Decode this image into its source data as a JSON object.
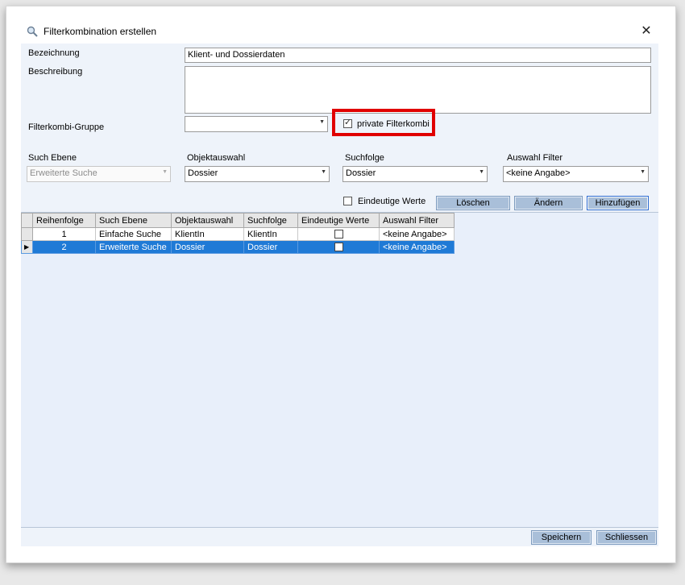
{
  "window": {
    "title": "Filterkombination erstellen",
    "close_symbol": "✕"
  },
  "form": {
    "bezeichnung_label": "Bezeichnung",
    "bezeichnung_value": "Klient- und Dossierdaten",
    "beschreibung_label": "Beschreibung",
    "beschreibung_value": "",
    "gruppe_label": "Filterkombi-Gruppe",
    "gruppe_value": "",
    "private_label": "private Filterkombi",
    "private_checked": true
  },
  "filter_row": {
    "such_ebene_label": "Such Ebene",
    "such_ebene_value": "Erweiterte Suche",
    "objektauswahl_label": "Objektauswahl",
    "objektauswahl_value": "Dossier",
    "suchfolge_label": "Suchfolge",
    "suchfolge_value": "Dossier",
    "auswahl_filter_label": "Auswahl Filter",
    "auswahl_filter_value": "<keine Angabe>",
    "eindeutige_label": "Eindeutige Werte",
    "eindeutige_checked": false
  },
  "buttons": {
    "loeschen": "Löschen",
    "aendern": "Ändern",
    "hinzufuegen": "Hinzufügen",
    "speichern": "Speichern",
    "schliessen": "Schliessen"
  },
  "grid": {
    "columns": [
      "Reihenfolge",
      "Such Ebene",
      "Objektauswahl",
      "Suchfolge",
      "Eindeutige Werte",
      "Auswahl Filter"
    ],
    "rows": [
      {
        "reihenfolge": "1",
        "such_ebene": "Einfache Suche",
        "objektauswahl": "KlientIn",
        "suchfolge": "KlientIn",
        "eindeutige": false,
        "auswahl_filter": "<keine Angabe>",
        "selected": false
      },
      {
        "reihenfolge": "2",
        "such_ebene": "Erweiterte Suche",
        "objektauswahl": "Dossier",
        "suchfolge": "Dossier",
        "eindeutige": false,
        "auswahl_filter": "<keine Angabe>",
        "selected": true
      }
    ],
    "current_row_marker": "▶"
  },
  "icons": {
    "title_icon": "magnifier-icon",
    "dropdown_icon": "chevron-down-icon",
    "check_glyph": "✓"
  },
  "colors": {
    "selection": "#1f7ad6",
    "highlight_box": "#e00000",
    "button_face": "#a9bfd9",
    "content_bg": "#eef3fa"
  }
}
